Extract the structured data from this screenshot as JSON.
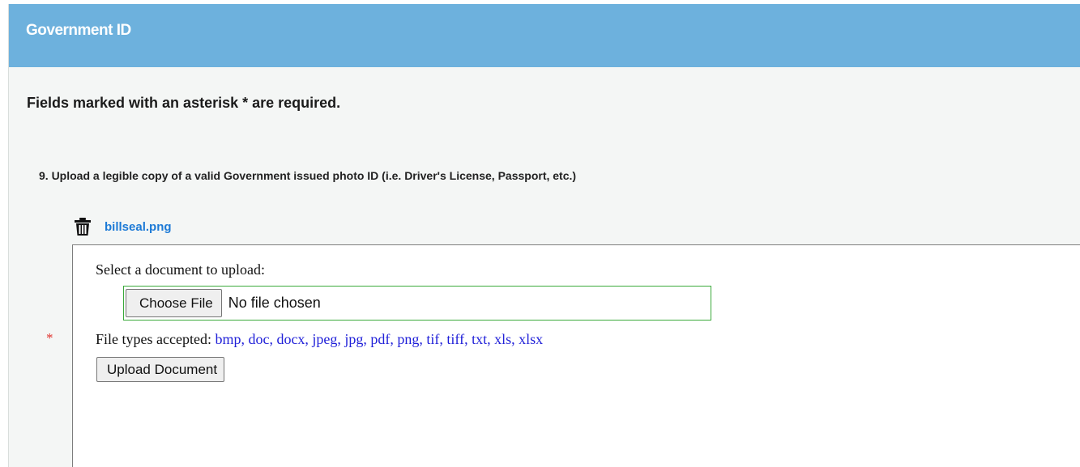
{
  "panel": {
    "title": "Government ID",
    "required_note": "Fields marked with an asterisk * are required."
  },
  "question": {
    "text": "9. Upload a legible copy of a valid Government issued photo ID (i.e. Driver's License, Passport, etc.)",
    "required_marker": "*"
  },
  "uploaded_file": {
    "name": "billseal.png",
    "delete_icon": "trash-icon"
  },
  "upload_form": {
    "select_label": "Select a document to upload:",
    "choose_file_label": "Choose File",
    "no_file_text": "No file chosen",
    "types_label": "File types accepted:",
    "types_list": "bmp, doc, docx, jpeg, jpg, pdf, png, tif, tiff, txt, xls, xlsx",
    "upload_button_label": "Upload Document"
  },
  "colors": {
    "header_bg": "#6db1dd",
    "link": "#1d7ad6",
    "file_types": "#1f1fd8",
    "asterisk": "#e0302a",
    "focus_border": "#3aa93a"
  }
}
